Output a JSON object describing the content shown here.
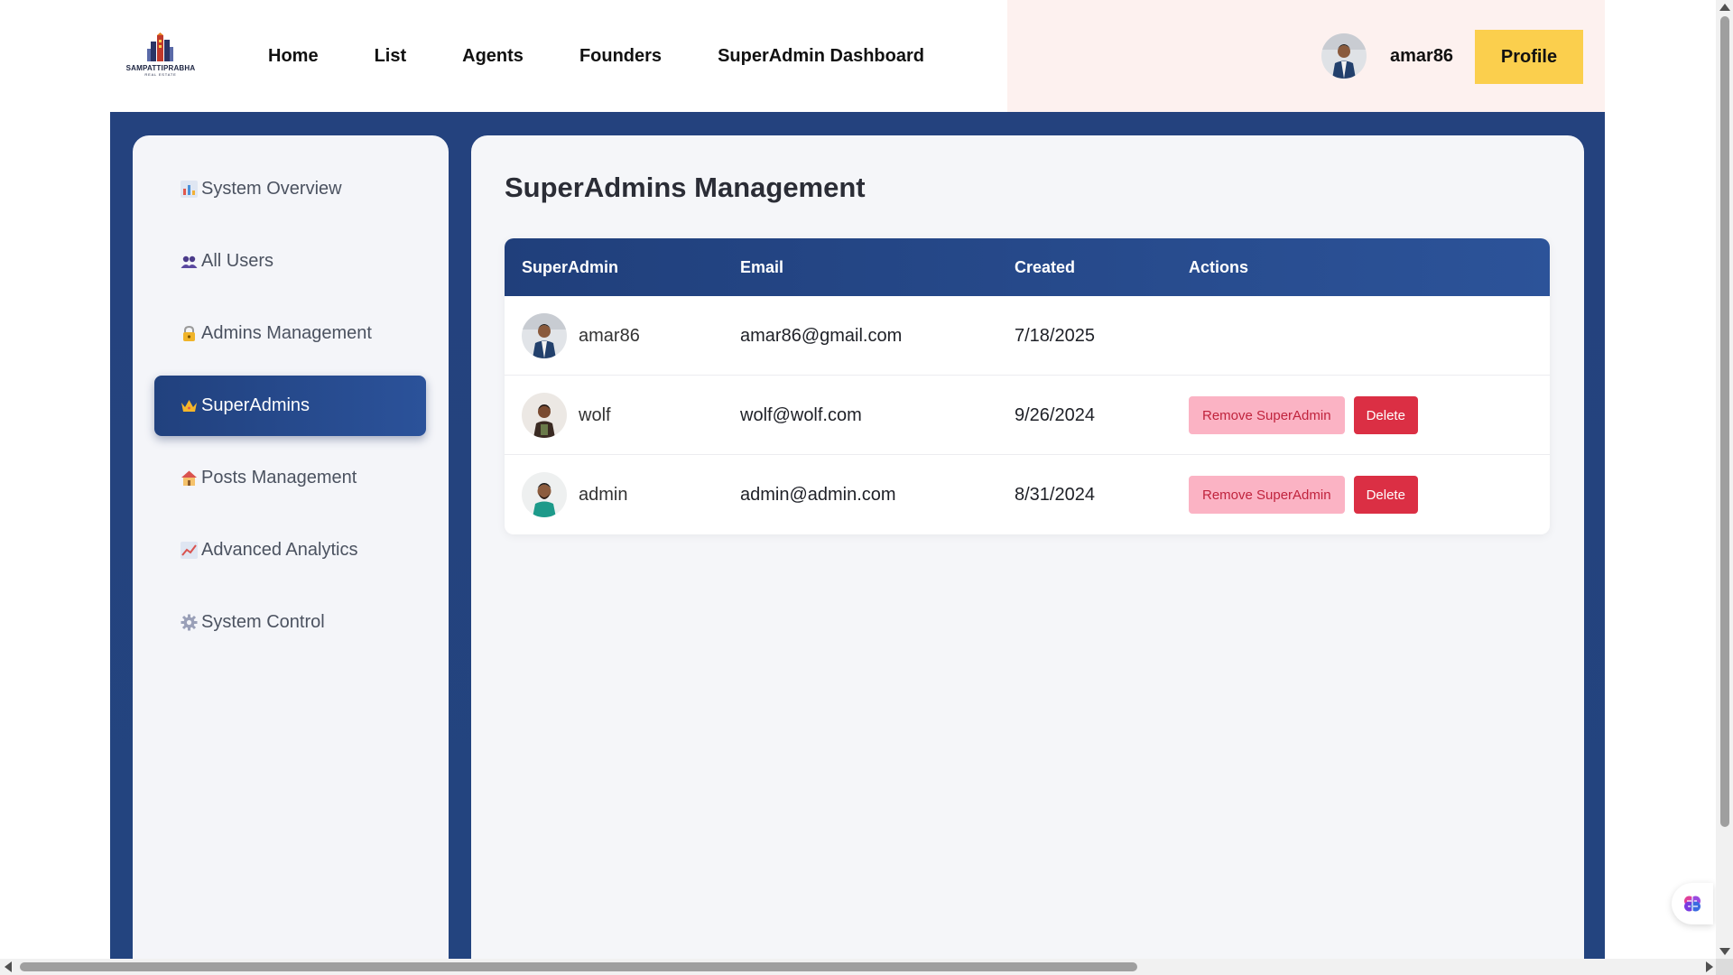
{
  "brand": {
    "name": "SAMPATTIPRABHA",
    "tagline": "REAL ESTATE"
  },
  "nav": {
    "links": [
      "Home",
      "List",
      "Agents",
      "Founders",
      "SuperAdmin Dashboard"
    ],
    "username": "amar86",
    "profile_label": "Profile"
  },
  "sidebar": {
    "items": [
      {
        "label": "System Overview",
        "icon": "bar-chart-icon"
      },
      {
        "label": "All Users",
        "icon": "users-icon"
      },
      {
        "label": "Admins Management",
        "icon": "lock-icon"
      },
      {
        "label": "SuperAdmins",
        "icon": "crown-icon",
        "active": true
      },
      {
        "label": "Posts Management",
        "icon": "house-icon"
      },
      {
        "label": "Advanced Analytics",
        "icon": "trend-chart-icon"
      },
      {
        "label": "System Control",
        "icon": "gear-icon"
      }
    ]
  },
  "main": {
    "title": "SuperAdmins Management",
    "table": {
      "columns": [
        "SuperAdmin",
        "Email",
        "Created",
        "Actions"
      ],
      "rows": [
        {
          "name": "amar86",
          "email": "amar86@gmail.com",
          "created": "7/18/2025",
          "actions": []
        },
        {
          "name": "wolf",
          "email": "wolf@wolf.com",
          "created": "9/26/2024",
          "actions": [
            "Remove SuperAdmin",
            "Delete"
          ]
        },
        {
          "name": "admin",
          "email": "admin@admin.com",
          "created": "8/31/2024",
          "actions": [
            "Remove SuperAdmin",
            "Delete"
          ]
        }
      ]
    }
  },
  "colors": {
    "frame": "#24427e",
    "accent": "#fbcf4d",
    "delete": "#db2f44",
    "remove": "#fbb3c4"
  }
}
